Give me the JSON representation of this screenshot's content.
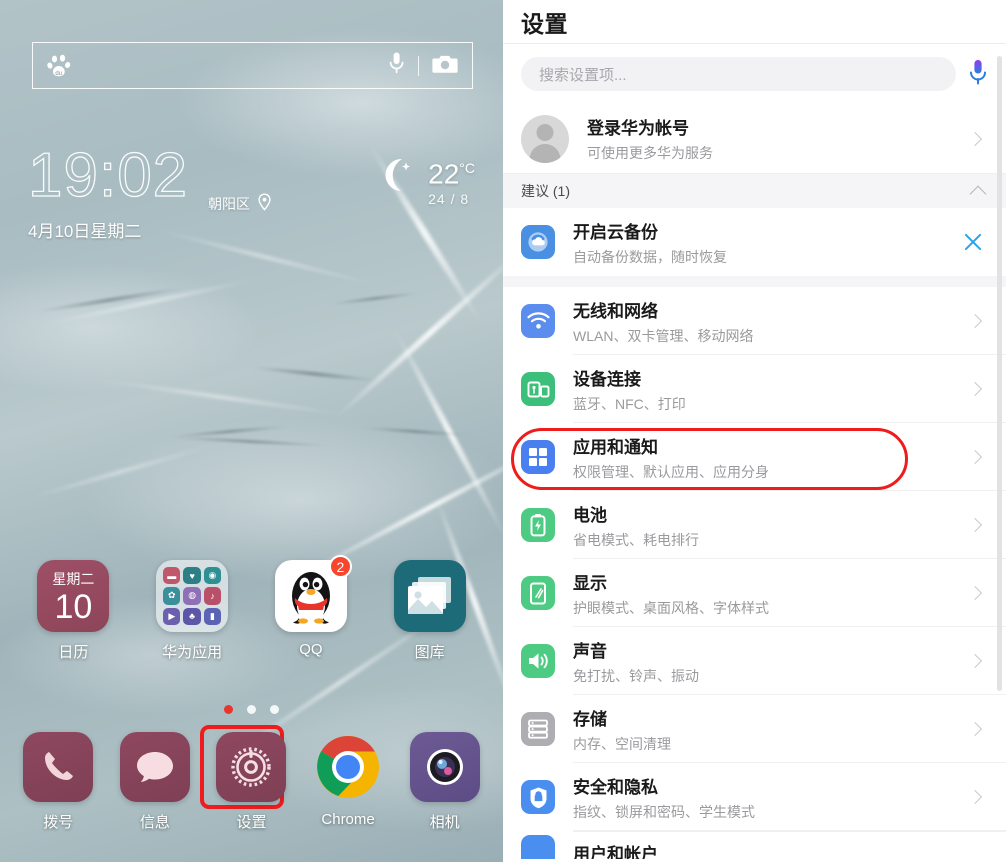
{
  "home": {
    "search_widget": {
      "brand_icon": "baidu-paw-icon",
      "mic_icon": "microphone-icon",
      "camera_icon": "camera-icon"
    },
    "clock": {
      "time": "19:02",
      "location": "朝阳区",
      "location_icon": "location-pin-icon",
      "date": "4月10日星期二"
    },
    "weather": {
      "icon": "moon-icon",
      "temp": "22",
      "unit": "°C",
      "range": "24 / 8"
    },
    "apps": [
      {
        "label": "日历",
        "icon": "calendar-icon",
        "weekday": "星期二",
        "day": "10",
        "badge": ""
      },
      {
        "label": "华为应用",
        "icon": "huawei-app-folder-icon",
        "badge": ""
      },
      {
        "label": "QQ",
        "icon": "qq-penguin-icon",
        "badge": "2"
      },
      {
        "label": "图库",
        "icon": "gallery-icon",
        "badge": ""
      }
    ],
    "page_dots": {
      "count": 3,
      "active": 1
    },
    "dock": [
      {
        "label": "拨号",
        "icon": "phone-icon",
        "highlighted": false
      },
      {
        "label": "信息",
        "icon": "message-icon",
        "highlighted": false
      },
      {
        "label": "设置",
        "icon": "gear-icon",
        "highlighted": true
      },
      {
        "label": "Chrome",
        "icon": "chrome-icon",
        "highlighted": false
      },
      {
        "label": "相机",
        "icon": "camera-lens-icon",
        "highlighted": false
      }
    ]
  },
  "settings": {
    "title": "设置",
    "search": {
      "placeholder": "搜索设置项...",
      "mic_icon": "microphone-icon"
    },
    "account": {
      "title": "登录华为帐号",
      "subtitle": "可使用更多华为服务",
      "avatar_icon": "avatar-icon"
    },
    "suggestion_section": {
      "label": "建议 (1)",
      "collapse_icon": "chevron-up-icon"
    },
    "suggestion_items": [
      {
        "title": "开启云备份",
        "subtitle": "自动备份数据，随时恢复",
        "icon": "cloud-backup-icon",
        "icon_color": "#4a90e2",
        "action_icon": "close-icon"
      }
    ],
    "items": [
      {
        "title": "无线和网络",
        "subtitle": "WLAN、双卡管理、移动网络",
        "icon": "wifi-icon",
        "icon_color": "#5b8def",
        "highlighted": false
      },
      {
        "title": "设备连接",
        "subtitle": "蓝牙、NFC、打印",
        "icon": "device-connect-icon",
        "icon_color": "#3cbf7a",
        "highlighted": false
      },
      {
        "title": "应用和通知",
        "subtitle": "权限管理、默认应用、应用分身",
        "icon": "apps-grid-icon",
        "icon_color": "#4a7ff0",
        "highlighted": true
      },
      {
        "title": "电池",
        "subtitle": "省电模式、耗电排行",
        "icon": "battery-icon",
        "icon_color": "#4ecb83",
        "highlighted": false
      },
      {
        "title": "显示",
        "subtitle": "护眼模式、桌面风格、字体样式",
        "icon": "display-icon",
        "icon_color": "#4ecb83",
        "highlighted": false
      },
      {
        "title": "声音",
        "subtitle": "免打扰、铃声、振动",
        "icon": "sound-icon",
        "icon_color": "#4ecb83",
        "highlighted": false
      },
      {
        "title": "存储",
        "subtitle": "内存、空间清理",
        "icon": "storage-icon",
        "icon_color": "#adadb2",
        "highlighted": false
      },
      {
        "title": "安全和隐私",
        "subtitle": "指纹、锁屏和密码、学生模式",
        "icon": "shield-icon",
        "icon_color": "#4a8ef0",
        "highlighted": false
      }
    ],
    "partial_item": {
      "title": "用户和帐户",
      "icon": "users-icon",
      "icon_color": "#4a8ef0"
    },
    "highlight_color": "#ee1c1c"
  }
}
